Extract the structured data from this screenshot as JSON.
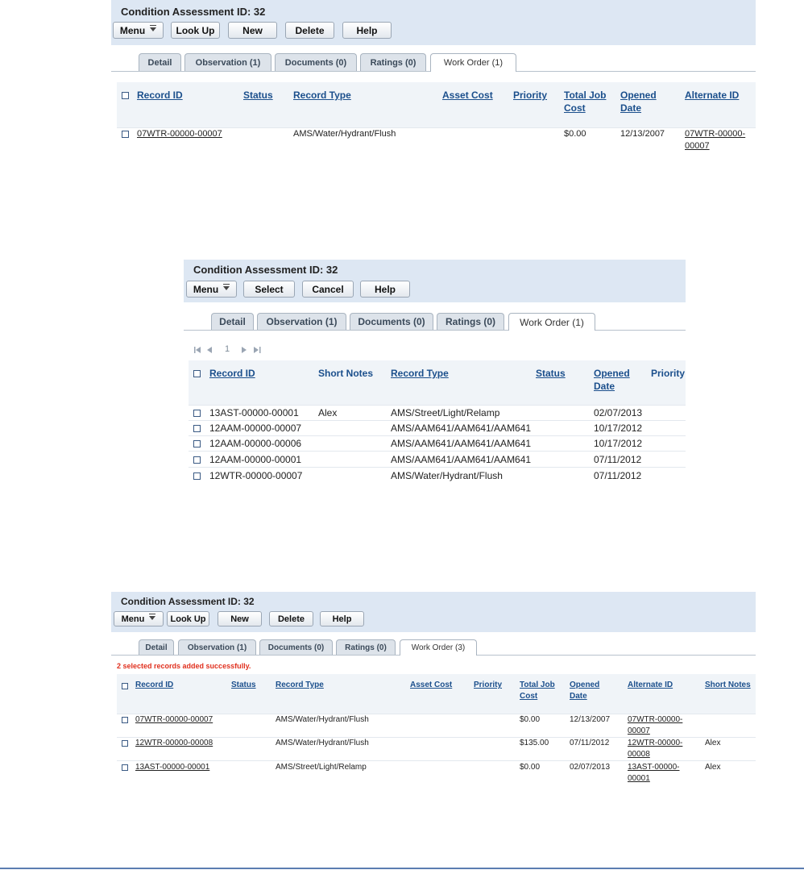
{
  "panel1": {
    "title": "Condition Assessment ID: 32",
    "buttons": [
      "Menu",
      "Look Up",
      "New",
      "Delete",
      "Help"
    ],
    "tabs": [
      "Detail",
      "Observation (1)",
      "Documents (0)",
      "Ratings (0)",
      "Work Order (1)"
    ],
    "columns": [
      "Record ID",
      "Status",
      "Record Type",
      "Asset Cost",
      "Priority",
      "Total Job\nCost",
      "Opened\nDate",
      "Alternate ID"
    ],
    "rows": [
      {
        "record_id": "07WTR-00000-00007",
        "status": "",
        "record_type": "AMS/Water/Hydrant/Flush",
        "asset_cost": "",
        "priority": "",
        "total_job_cost": "$0.00",
        "opened_date": "12/13/2007",
        "alternate_id": "07WTR-00000-\n00007"
      }
    ]
  },
  "panel2": {
    "title": "Condition Assessment ID: 32",
    "buttons": [
      "Menu",
      "Select",
      "Cancel",
      "Help"
    ],
    "tabs": [
      "Detail",
      "Observation (1)",
      "Documents (0)",
      "Ratings (0)",
      "Work Order (1)"
    ],
    "pager": {
      "page": "1"
    },
    "columns": [
      "Record ID",
      "Short Notes",
      "Record Type",
      "Status",
      "Opened\nDate",
      "Priority"
    ],
    "rows": [
      {
        "record_id": "13AST-00000-00001",
        "short_notes": "Alex",
        "record_type": "AMS/Street/Light/Relamp",
        "status": "",
        "opened_date": "02/07/2013"
      },
      {
        "record_id": "12AAM-00000-00007",
        "short_notes": "",
        "record_type": "AMS/AAM641/AAM641/AAM641",
        "status": "",
        "opened_date": "10/17/2012"
      },
      {
        "record_id": "12AAM-00000-00006",
        "short_notes": "",
        "record_type": "AMS/AAM641/AAM641/AAM641",
        "status": "",
        "opened_date": "10/17/2012"
      },
      {
        "record_id": "12AAM-00000-00001",
        "short_notes": "",
        "record_type": "AMS/AAM641/AAM641/AAM641",
        "status": "",
        "opened_date": "07/11/2012"
      },
      {
        "record_id": "12WTR-00000-00007",
        "short_notes": "",
        "record_type": "AMS/Water/Hydrant/Flush",
        "status": "",
        "opened_date": "07/11/2012"
      }
    ]
  },
  "panel3": {
    "title": "Condition Assessment ID: 32",
    "buttons": [
      "Menu",
      "Look Up",
      "New",
      "Delete",
      "Help"
    ],
    "tabs": [
      "Detail",
      "Observation (1)",
      "Documents (0)",
      "Ratings (0)",
      "Work Order (3)"
    ],
    "message": "2 selected records added successfully.",
    "columns": [
      "Record ID",
      "Status",
      "Record Type",
      "Asset Cost",
      "Priority",
      "Total Job\nCost",
      "Opened\nDate",
      "Alternate ID",
      "Short Notes"
    ],
    "rows": [
      {
        "record_id": "07WTR-00000-00007",
        "record_type": "AMS/Water/Hydrant/Flush",
        "total_job_cost": "$0.00",
        "opened_date": "12/13/2007",
        "alternate_id": "07WTR-00000-\n00007",
        "short_notes": ""
      },
      {
        "record_id": "12WTR-00000-00008",
        "record_type": "AMS/Water/Hydrant/Flush",
        "total_job_cost": "$135.00",
        "opened_date": "07/11/2012",
        "alternate_id": "12WTR-00000-\n00008",
        "short_notes": "Alex"
      },
      {
        "record_id": "13AST-00000-00001",
        "record_type": "AMS/Street/Light/Relamp",
        "total_job_cost": "$0.00",
        "opened_date": "02/07/2013",
        "alternate_id": "13AST-00000-\n00001",
        "short_notes": "Alex"
      }
    ]
  }
}
